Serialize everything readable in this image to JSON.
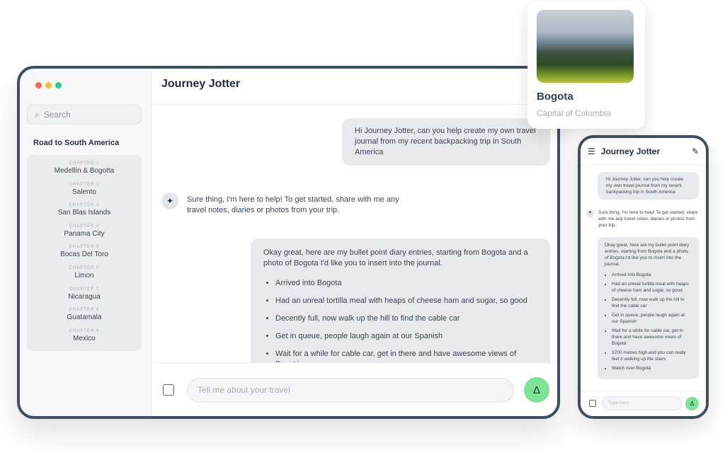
{
  "app": {
    "title": "Journey Jotter",
    "window_dots": [
      "#ee6b4d",
      "#f6be2c",
      "#2ec88a"
    ]
  },
  "sidebar": {
    "search_placeholder": "Search",
    "section_title": "Road to South America",
    "chapters": [
      {
        "label": "CHAPTER 1",
        "name": "Medellín & Bogotta"
      },
      {
        "label": "CHAPTER 2",
        "name": "Salento"
      },
      {
        "label": "CHAPTER 3",
        "name": "San Blas Islands"
      },
      {
        "label": "CHAPTER 4",
        "name": "Panama City"
      },
      {
        "label": "CHAPTER 5",
        "name": "Bocas Del Toro"
      },
      {
        "label": "CHAPTER 6",
        "name": "Limon"
      },
      {
        "label": "CHAPTER 7",
        "name": "Nicaragua"
      },
      {
        "label": "CHAPTER 8",
        "name": "Guatamala"
      },
      {
        "label": "CHAPTER 9",
        "name": "Mexico"
      }
    ]
  },
  "chat": {
    "user_msg_1": "Hi Journey Jotter, can you help create my own travel journal from my recent backpacking trip in South America",
    "bot_msg_1": "Sure thing, I'm here to help! To get started, share with me any travel notes, diaries or photos from your trip.",
    "user_msg_2": "Okay great, here are my bullet point diary entries, starting from Bogota and a photo of Bogota I'd like you to insert into the journal.",
    "bullets": [
      "Arrived into Bogota",
      "Had an unreal tortilla meal with heaps of cheese ham and sugar, so good",
      "Decently full, now walk up the hill to find the cable car",
      "Get in queue, people laugh again at our Spanish",
      "Wait for a while for cable car, get in there and have awesome views of Bogotá",
      "3700 metres high and you can really feel it walking up the stairs",
      "Watch over Bogotá"
    ],
    "input_placeholder": "Tell me about your travel",
    "send_icon": "Δ"
  },
  "card": {
    "title": "Bogota",
    "subtitle": "Capital of Colombia"
  },
  "phone": {
    "title": "Journey Jotter",
    "input_placeholder": "Type here"
  },
  "colors": {
    "accent": "#7de495",
    "frame": "#3e4f63"
  }
}
